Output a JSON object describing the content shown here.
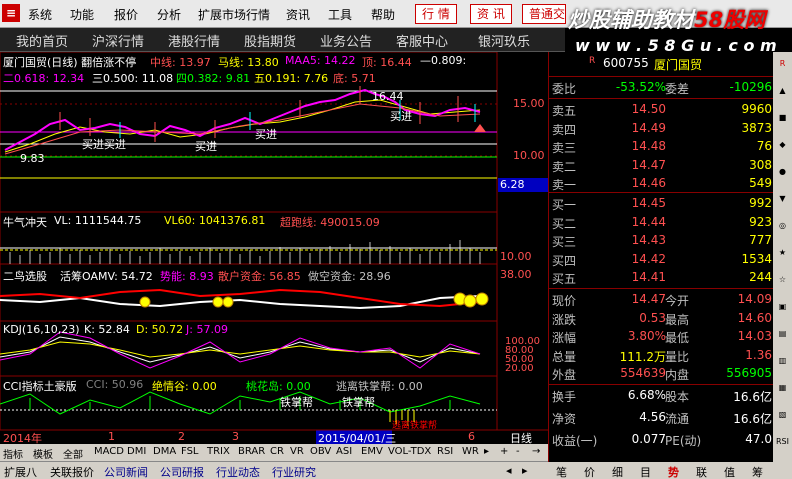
{
  "menu": {
    "items": [
      "系统",
      "功能",
      "报价",
      "分析",
      "扩展市场行情",
      "资讯",
      "工具",
      "帮助"
    ],
    "buttons": [
      "行 情",
      "资 讯",
      "普通交易"
    ]
  },
  "watermark": {
    "main": "炒股辅助教材",
    "red": "58股网",
    "url": "w w w . 5 8 G u . c o m"
  },
  "nav": {
    "items": [
      "我的首页",
      "沪深行情",
      "港股行情",
      "股指期货",
      "业务公告",
      "客服中心",
      "银河玖乐"
    ]
  },
  "main_panel": {
    "title": "厦门国贸(日线) 翻倍涨不停",
    "indicators": [
      {
        "label": "中线: 13.97",
        "color": "#ff5050"
      },
      {
        "label": "马线: 13.80",
        "color": "#ffff00"
      },
      {
        "label": "MAA5: 14.22",
        "color": "#ff00ff"
      },
      {
        "label": "顶: 16.44",
        "color": "#ff5050"
      },
      {
        "label": "—0.809:",
        "color": "#ffffff"
      }
    ],
    "fib": [
      {
        "label": "二0.618: 12.34",
        "color": "#ff00ff"
      },
      {
        "label": "三0.500: 11.08",
        "color": "#ffffff"
      },
      {
        "label": "四0.382: 9.81",
        "color": "#00ff00"
      },
      {
        "label": "五0.191: 7.76",
        "color": "#ffff00"
      },
      {
        "label": "底: 5.71",
        "color": "#ff5050"
      }
    ],
    "price_labels": [
      "15.00",
      "10.00"
    ],
    "current_box": "6.28",
    "annotations": [
      "16.44",
      "9.83",
      "买进买进",
      "买进",
      "买进",
      "买进"
    ]
  },
  "volume_panel": {
    "title": "牛气冲天",
    "vl": "VL: 1111544.75",
    "vl60": "VL60: 1041376.81",
    "special": "超跑线: 490015.09",
    "axis": "10.00"
  },
  "bird_panel": {
    "title": "二鸟选股",
    "items": [
      {
        "label": "活筹OAMV: 54.72",
        "color": "#ffffff"
      },
      {
        "label": "势能: 8.93",
        "color": "#ff00ff"
      },
      {
        "label": "散户资金: 56.85",
        "color": "#ff5050"
      },
      {
        "label": "做空资金: 28.96",
        "color": "#c0c0c0"
      }
    ],
    "axis": "38.00"
  },
  "kdj_panel": {
    "title": "KDJ(16,10,23)",
    "k": "K: 52.84",
    "d": "D: 50.72",
    "j": "J: 57.09",
    "axis": [
      "100.00",
      "80.00",
      "50.00",
      "20.00"
    ]
  },
  "cci_panel": {
    "title": "CCI指标土豪版",
    "cci": "CCI: 50.96",
    "items": [
      {
        "label": "绝情谷: 0.00",
        "color": "#ffff00"
      },
      {
        "label": "桃花岛: 0.00",
        "color": "#00ff00"
      },
      {
        "label": "逃离铁掌帮: 0.00",
        "color": "#c0c0c0"
      }
    ],
    "annotations": [
      "铁掌帮",
      "铁掌帮",
      "逃离铁掌帮"
    ]
  },
  "time_axis": {
    "year": "2014年",
    "ticks": [
      "1",
      "2",
      "3"
    ],
    "selected_date": "2015/04/01/三",
    "tick6": "6",
    "period": "日线"
  },
  "indicator_tabs": [
    "指标",
    "模板",
    "全部",
    "MACD",
    "DMI",
    "DMA",
    "FSL",
    "TRIX",
    "BRAR",
    "CR",
    "VR",
    "OBV",
    "ASI",
    "EMV",
    "VOL-TDX",
    "RSI",
    "WR"
  ],
  "info_tabs": [
    "扩展八",
    "关联报价",
    "公司新闻",
    "公司研报",
    "行业动态",
    "行业研究"
  ],
  "quote": {
    "code": "600755",
    "name": "厦门国贸",
    "weibi_label": "委比",
    "weibi": "-53.52%",
    "weicha_label": "委差",
    "weicha": "-10296",
    "asks": [
      {
        "label": "卖五",
        "price": "14.50",
        "vol": "9960"
      },
      {
        "label": "卖四",
        "price": "14.49",
        "vol": "3873"
      },
      {
        "label": "卖三",
        "price": "14.48",
        "vol": "76"
      },
      {
        "label": "卖二",
        "price": "14.47",
        "vol": "308"
      },
      {
        "label": "卖一",
        "price": "14.46",
        "vol": "549"
      }
    ],
    "bids": [
      {
        "label": "买一",
        "price": "14.45",
        "vol": "992"
      },
      {
        "label": "买二",
        "price": "14.44",
        "vol": "923"
      },
      {
        "label": "买三",
        "price": "14.43",
        "vol": "777"
      },
      {
        "label": "买四",
        "price": "14.42",
        "vol": "1534"
      },
      {
        "label": "买五",
        "price": "14.41",
        "vol": "244"
      }
    ],
    "stats1": [
      {
        "l": "现价",
        "v": "14.47",
        "l2": "今开",
        "v2": "14.09"
      },
      {
        "l": "涨跌",
        "v": "0.53",
        "l2": "最高",
        "v2": "14.60"
      },
      {
        "l": "涨幅",
        "v": "3.80%",
        "l2": "最低",
        "v2": "14.03"
      },
      {
        "l": "总量",
        "v": "111.2万",
        "l2": "量比",
        "v2": "1.36"
      },
      {
        "l": "外盘",
        "v": "554639",
        "l2": "内盘",
        "v2": "556905"
      }
    ],
    "stats2": [
      {
        "l": "换手",
        "v": "6.68%",
        "l2": "股本",
        "v2": "16.6亿"
      },
      {
        "l": "净资",
        "v": "4.56",
        "l2": "流通",
        "v2": "16.6亿"
      },
      {
        "l": "收益(一)",
        "v": "0.077",
        "l2": "PE(动)",
        "v2": "47.0"
      }
    ]
  },
  "quote_tabs": [
    "笔",
    "价",
    "细",
    "目",
    "势",
    "联",
    "值",
    "筹"
  ],
  "rtool": [
    "R",
    "▲",
    "■",
    "◆",
    "●",
    "▼",
    "◎",
    "★",
    "☆",
    "▣",
    "▤",
    "▥",
    "▦",
    "▧",
    "RSI"
  ]
}
